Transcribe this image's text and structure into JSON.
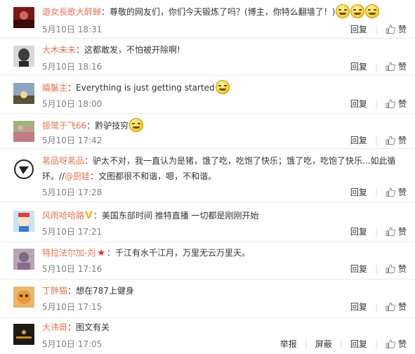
{
  "actions": {
    "reply": "回复",
    "like": "赞",
    "report": "举报",
    "block": "屏蔽"
  },
  "comments": [
    {
      "user": "遊女長歌大醉歸",
      "sep": "：",
      "content": "尊敬的网友们，你们今天锻炼了吗？(博主，你特么翻墙了！)",
      "time": "5月10日 18:31"
    },
    {
      "user": "大木未未",
      "sep": "：",
      "content": "这都敢发，不怕被开除啊!",
      "time": "5月10日 18:16"
    },
    {
      "user": "孀鬣主",
      "sep": "：",
      "content": "Everything is just getting started",
      "time": "5月10日 18:00"
    },
    {
      "user": "振鹭于飞66",
      "sep": "：",
      "content": "黔驴技穷",
      "time": "5月10日 17:42"
    },
    {
      "user": "茗品呀茗品",
      "sep": "：",
      "content": "驴太不对，我一直认为是猪，饿了吃，吃饱了快乐；饿了吃，吃饱了快乐...如此循环。//",
      "mention": "@厨娃",
      "content2": "：文图都很不和谐，嗯，不和谐。",
      "time": "5月10日 17:28"
    },
    {
      "user": "风雨哈哈路",
      "sep": "：",
      "content": "美国东部时间 推特直播 一切都是刚刚开始",
      "time": "5月10日 17:21"
    },
    {
      "user": "特拉法尔加-刘",
      "sep": "：",
      "content": "千江有水千江月，万里无云万里天。",
      "time": "5月10日 17:16"
    },
    {
      "user": "丁胖猫",
      "sep": "：",
      "content": "想在787上健身",
      "time": "5月10日 17:15"
    },
    {
      "user": "大讳哥",
      "sep": "：",
      "content": "图文有关",
      "time": "5月10日 17:05"
    }
  ]
}
